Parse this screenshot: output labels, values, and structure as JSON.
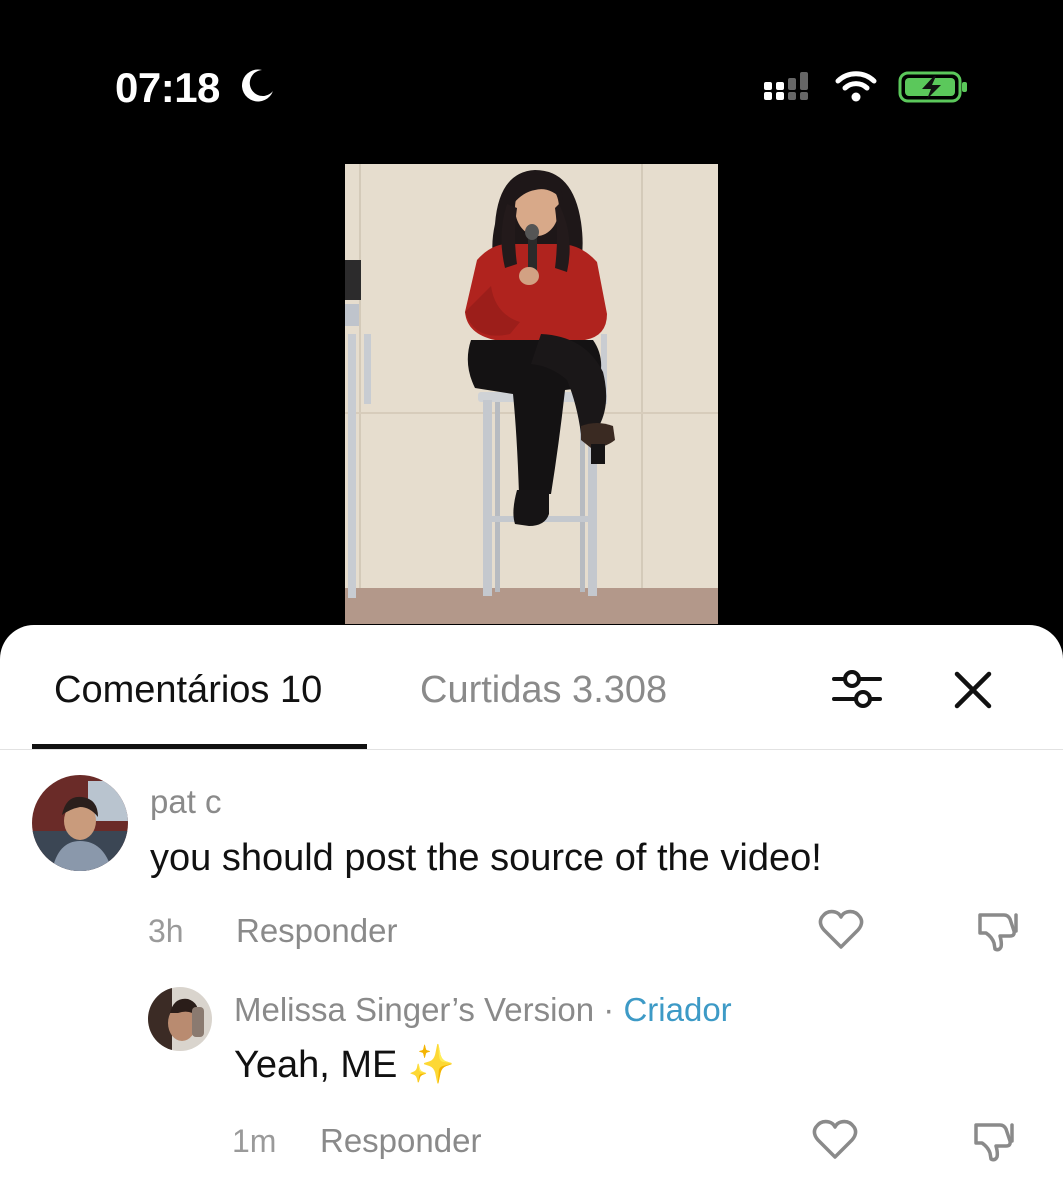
{
  "status_bar": {
    "time": "07:18",
    "icons": [
      "moon-icon",
      "cellular-signal-icon",
      "wifi-icon",
      "battery-charging-icon"
    ],
    "battery_color": "#5bc85b"
  },
  "video": {
    "icon": "video-frame"
  },
  "sheet": {
    "tabs": [
      {
        "label": "Comentários 10",
        "active": true
      },
      {
        "label": "Curtidas 3.308",
        "active": false
      }
    ],
    "filter_icon": "filter-sliders-icon",
    "close_icon": "close-icon"
  },
  "comments": [
    {
      "username": "pat c",
      "text": "you should post the source of the video!",
      "time": "3h",
      "reply_label": "Responder"
    },
    {
      "username": "Melissa Singer’s Version",
      "separator": "·",
      "badge": "Criador",
      "text": "Yeah, ME ✨",
      "time": "1m",
      "reply_label": "Responder"
    }
  ],
  "colors": {
    "accent_creator": "#3d9ac6",
    "muted_text": "#8a8a8a",
    "primary_text": "#111111"
  }
}
